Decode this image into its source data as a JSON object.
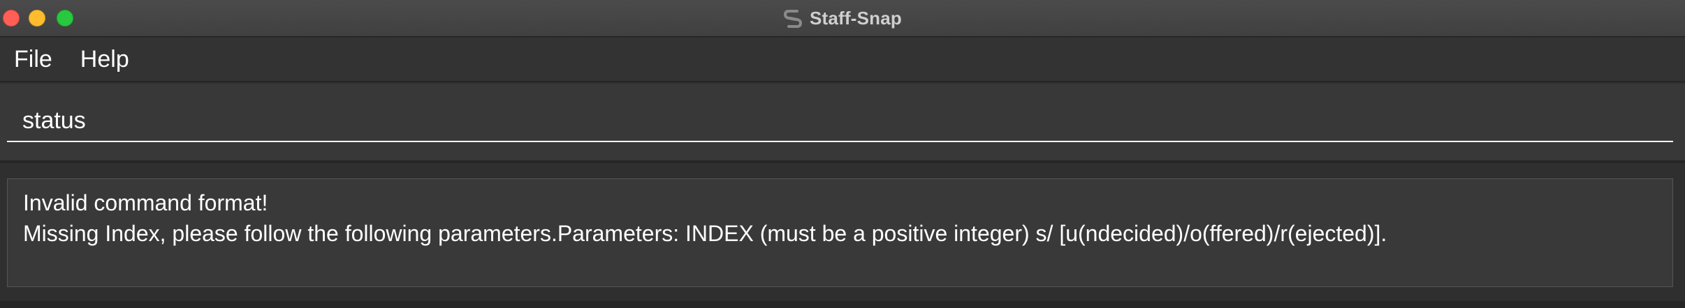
{
  "window": {
    "title": "Staff-Snap",
    "app_icon": "staff-snap-logo-icon"
  },
  "menu": {
    "items": [
      "File",
      "Help"
    ]
  },
  "command_box": {
    "value": "status"
  },
  "result_display": {
    "lines": [
      "Invalid command format!",
      "Missing Index, please follow the following parameters.Parameters: INDEX (must be a positive integer) s/ [u(ndecided)/o(ffered)/r(ejected)]."
    ]
  },
  "colors": {
    "background": "#2f2f2f",
    "text": "#ffffff",
    "close": "#ff5f57",
    "minimize": "#febc2e",
    "maximize": "#28c840"
  }
}
